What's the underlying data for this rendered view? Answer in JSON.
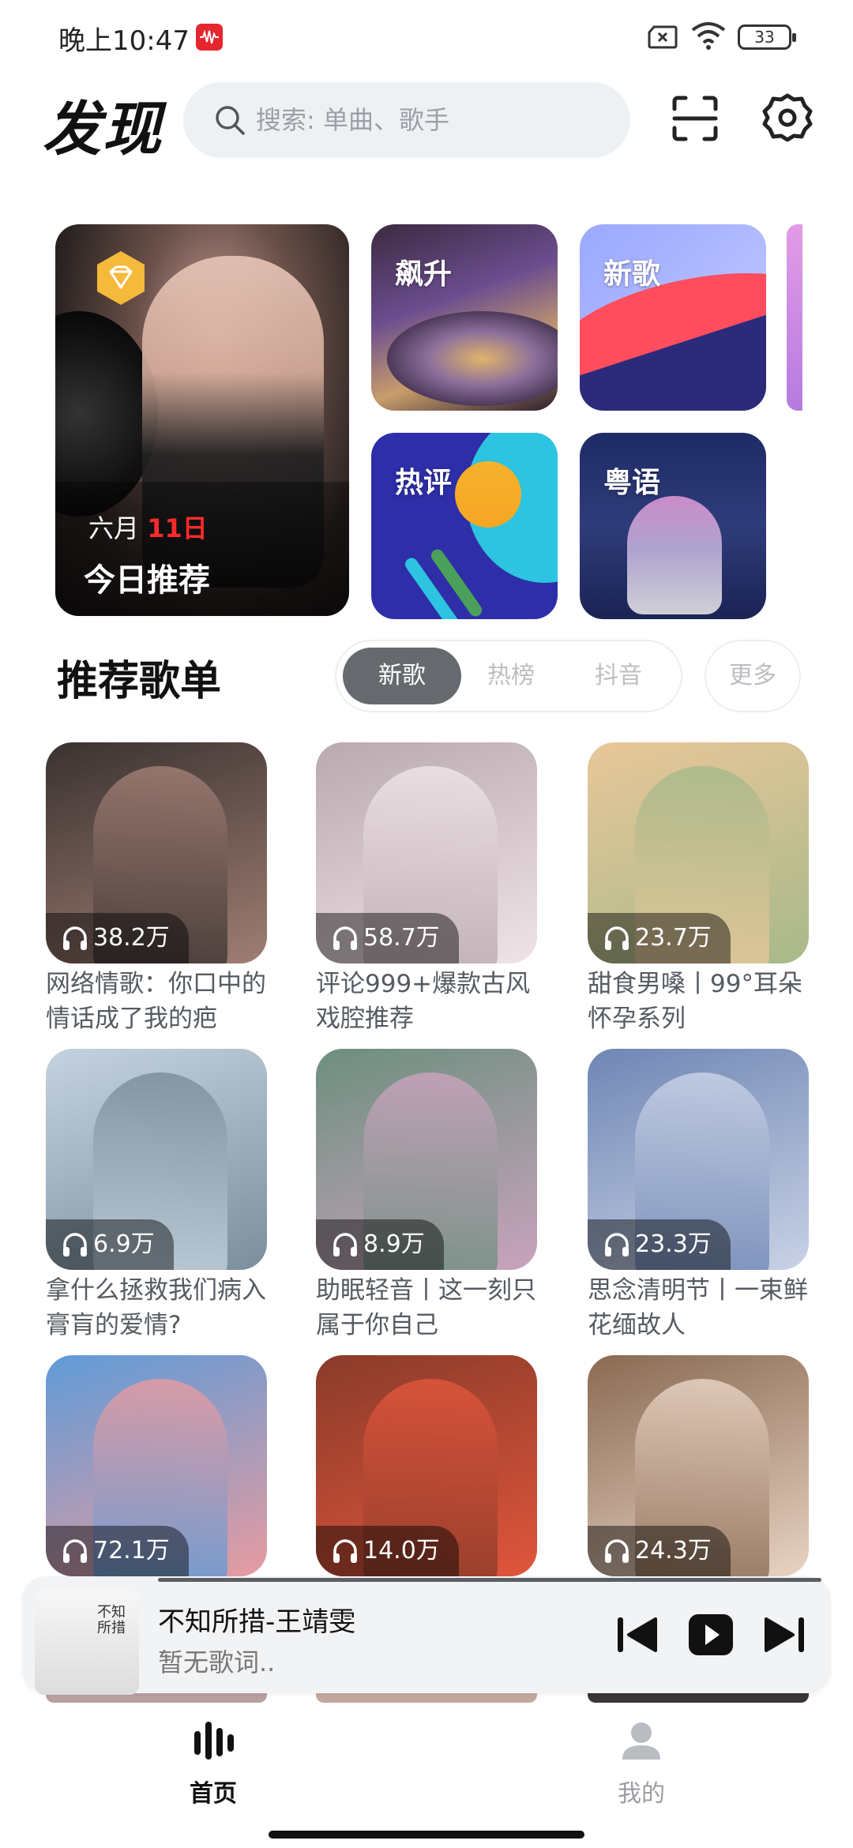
{
  "status_bar": {
    "time": "晚上10:47",
    "battery": "33"
  },
  "header": {
    "title": "发现",
    "search_placeholder": "搜索: 单曲、歌手",
    "scan_icon": "scan-icon",
    "settings_icon": "gear-icon"
  },
  "hero": {
    "main": {
      "month": "六月",
      "day": "11日",
      "label": "今日推荐"
    },
    "tiles": [
      {
        "label": "飙升"
      },
      {
        "label": "新歌"
      },
      {
        "label": "热评"
      },
      {
        "label": "粤语"
      }
    ]
  },
  "playlists": {
    "title": "推荐歌单",
    "tabs": [
      "新歌",
      "热榜",
      "抖音"
    ],
    "active_tab": "新歌",
    "more": "更多",
    "items": [
      {
        "count": "38.2万",
        "title": "网络情歌：你口中的情话成了我的疤",
        "colors": [
          "#3a3230",
          "#a07e74"
        ]
      },
      {
        "count": "58.7万",
        "title": "评论999+爆款古风戏腔推荐",
        "colors": [
          "#b9a9b0",
          "#f0e3e8"
        ]
      },
      {
        "count": "23.7万",
        "title": "甜食男嗓丨99°耳朵怀孕系列",
        "colors": [
          "#e9c79a",
          "#a7b98a"
        ]
      },
      {
        "count": "6.9万",
        "title": "拿什么拯救我们病入膏肓的爱情?",
        "colors": [
          "#c4d3df",
          "#7b8e9c"
        ]
      },
      {
        "count": "8.9万",
        "title": "助眠轻音丨这一刻只属于你自己",
        "colors": [
          "#6d8f7e",
          "#c9a3bd"
        ]
      },
      {
        "count": "23.3万",
        "title": "思念清明节丨一束鲜花缅故人",
        "colors": [
          "#6f86b4",
          "#c9d2e6"
        ]
      },
      {
        "count": "72.1万",
        "title": "",
        "colors": [
          "#5f9bd8",
          "#e79ba0"
        ]
      },
      {
        "count": "14.0万",
        "title": "",
        "colors": [
          "#8a3b2a",
          "#e0553c"
        ]
      },
      {
        "count": "24.3万",
        "title": "",
        "colors": [
          "#8a6a52",
          "#e8d3c3"
        ]
      }
    ]
  },
  "player": {
    "song": "不知所措-王靖雯",
    "lyrics": "暂无歌词..",
    "cover_text": "不知所措",
    "progress": 1.0
  },
  "nav": {
    "home": "首页",
    "mine": "我的"
  },
  "colors": {
    "accent": "#666a6e",
    "badge_red": "#e5262f",
    "day_red": "#ff2a2a"
  }
}
